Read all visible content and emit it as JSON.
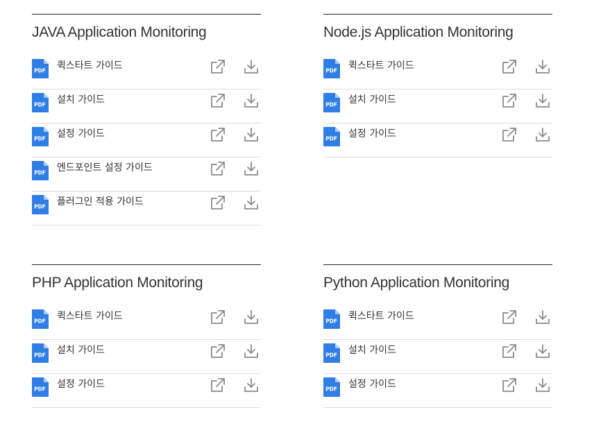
{
  "colors": {
    "pdf_blue": "#2f7ee6",
    "icon_gray": "#8a8a8a",
    "divider": "#dddddd",
    "header_rule": "#222222"
  },
  "icons": {
    "doc": "pdf-icon",
    "open": "external-link-icon",
    "download": "download-icon"
  },
  "pdf_label": "PDF",
  "sections": [
    {
      "title": "JAVA Application Monitoring",
      "docs": [
        "퀵스타트 가이드",
        "설치 가이드",
        "설정 가이드",
        "엔드포인트 설정 가이드",
        "플러그인 적용 가이드"
      ]
    },
    {
      "title": "Node.js Application Monitoring",
      "docs": [
        "퀵스타트 가이드",
        "설치 가이드",
        "설정 가이드"
      ]
    },
    {
      "title": "PHP Application Monitoring",
      "docs": [
        "퀵스타트 가이드",
        "설치 가이드",
        "설정 가이드"
      ]
    },
    {
      "title": "Python Application Monitoring",
      "docs": [
        "퀵스타트 가이드",
        "설치 가이드",
        "설정 가이드"
      ]
    }
  ]
}
